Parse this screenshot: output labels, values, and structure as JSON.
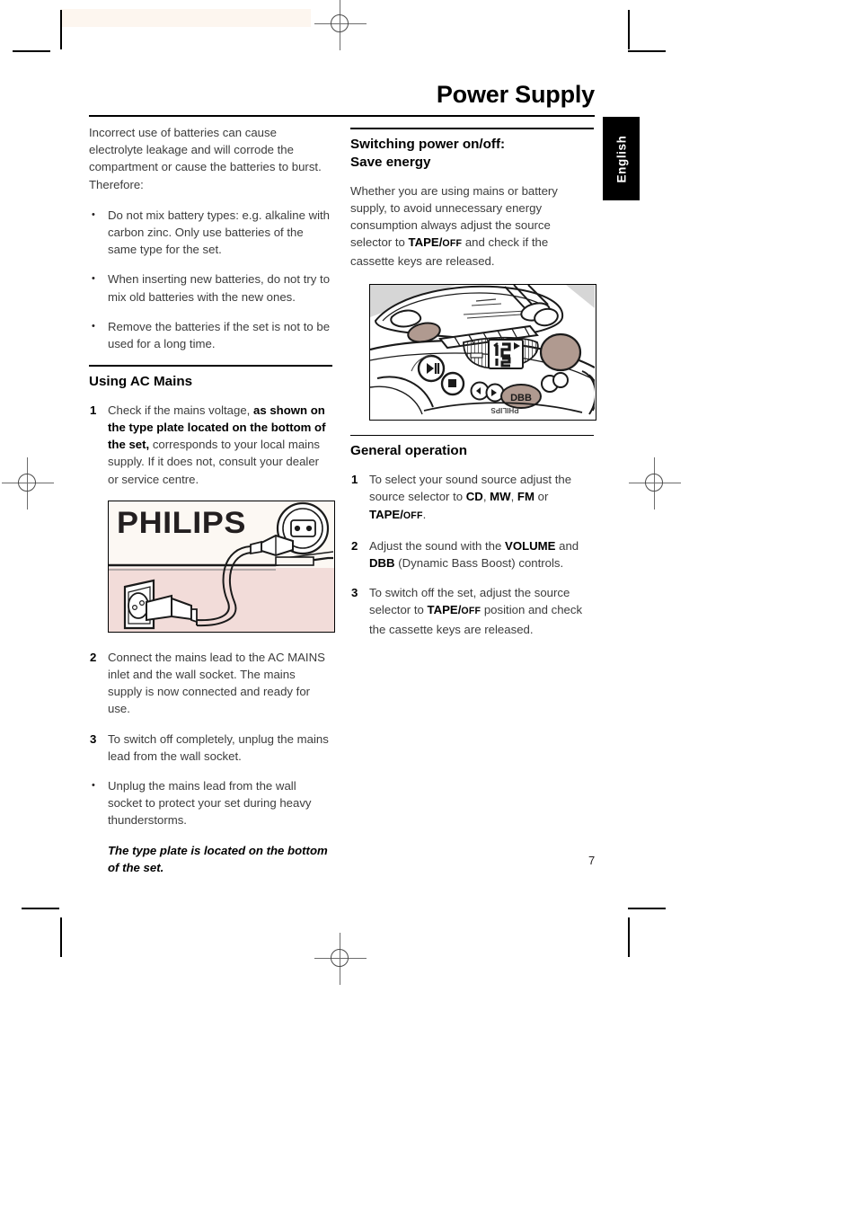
{
  "page": {
    "title": "Power Supply",
    "language_tab": "English",
    "page_number": "7"
  },
  "left_column": {
    "intro": "Incorrect use of batteries can cause electrolyte leakage and will corrode the compartment or cause the batteries to burst. Therefore:",
    "bullets": [
      {
        "marker": "•",
        "text": "Do not mix battery types: e.g. alkaline with carbon zinc. Only use batteries of the same type for the set."
      },
      {
        "marker": "•",
        "text": "When inserting new batteries, do not try to mix old batteries with the new ones."
      },
      {
        "marker": "•",
        "text": "Remove the batteries if the set is not to be used for a long time."
      }
    ],
    "section": {
      "heading": "Using AC Mains",
      "step1": {
        "marker": "1",
        "part_a": "Check if the mains voltage, ",
        "part_b_bold": "as shown on the type plate located on the bottom of the set,",
        "part_c": " corresponds to your local mains supply. If it does not, consult your dealer or service centre."
      },
      "figure": {
        "name": "mains-connection-illustration",
        "brand_text": "PHILIPS",
        "colors": {
          "panel_top": "#fcf8f3",
          "panel_bottom": "#f2dcd9",
          "outline": "#000000"
        }
      },
      "step2": {
        "marker": "2",
        "text": "Connect the mains lead to the AC MAINS inlet and the wall socket. The mains supply is now connected and ready for use."
      },
      "step3": {
        "marker": "3",
        "text": "To switch off completely, unplug the mains lead from the wall socket."
      },
      "bullet": {
        "marker": "•",
        "text": "Unplug the mains lead from the wall socket to protect your set during heavy thunderstorms."
      },
      "note": "The type plate is located on the bottom of the set."
    }
  },
  "right_column": {
    "section_switching": {
      "heading_line1": "Switching power on/off:",
      "heading_line2": "Save energy",
      "body_a": "Whether you are using mains or battery supply, to avoid unnecessary energy consumption always adjust the source selector to ",
      "body_bold_tape": "TAPE/",
      "body_bold_off": "OFF",
      "body_b": " and check if the cassette keys are released."
    },
    "figure": {
      "name": "cd-player-control-panel-illustration",
      "display_text": "12",
      "dbb_label": "DBB",
      "brand_text": "PHILIPS",
      "colors": {
        "accent": "#b09a90",
        "outline": "#1a1a1a",
        "panel": "#ffffff"
      }
    },
    "section_general": {
      "heading": "General operation",
      "steps": [
        {
          "marker": "1",
          "part_a": "To select your sound source adjust the source selector to ",
          "bold_tokens": [
            "CD",
            "MW",
            "FM"
          ],
          "joiner_1": ", ",
          "joiner_2": ", ",
          "joiner_or": " or ",
          "bold_tape": "TAPE/",
          "bold_off": "OFF",
          "part_end": "."
        },
        {
          "marker": "2",
          "part_a": "Adjust the sound with the ",
          "bold_volume": "VOLUME",
          "part_b": " and ",
          "bold_dbb": "DBB",
          "part_c": " (Dynamic Bass Boost) controls."
        },
        {
          "marker": "3",
          "part_a": "To switch off the set, adjust the source selector to ",
          "bold_tape": "TAPE/",
          "bold_off": "OFF",
          "part_b": " position and check the cassette keys are released."
        }
      ]
    }
  }
}
